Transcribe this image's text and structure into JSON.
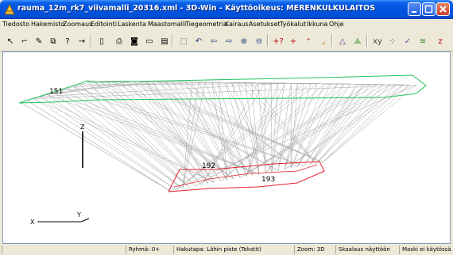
{
  "window": {
    "title": "rauma_12m_rk7_viivamalli_20316.xml - 3D-Win - Käyttöoikeus: MERENKULKULAITOS"
  },
  "menu": [
    "Tiedosto",
    "Hakemisto",
    "Zoomaus",
    "Editointi",
    "Laskenta",
    "Maastomalli",
    "Tiegeometria",
    "Kairaus",
    "Asetukset",
    "Työkalut",
    "Ikkuna",
    "Ohje"
  ],
  "toolbar_icons": [
    "new-point-icon",
    "new-line-icon",
    "edit-icon",
    "copy-icon",
    "query-icon",
    "move-icon",
    "page-icon",
    "print-icon",
    "camera-icon",
    "window-icon",
    "export-icon",
    "zoom-all-icon",
    "undo-zoom-icon",
    "pan-left-icon",
    "pan-right-icon",
    "zoom-in-icon",
    "zoom-out-icon",
    "info-icon",
    "add-point-icon",
    "add-vertex-icon",
    "line-icon",
    "triangle-icon",
    "triangulate-icon",
    "coordinates-icon",
    "grid-points-icon",
    "check-icon",
    "contour-icon",
    "elevation-icon"
  ],
  "canvas": {
    "labels": {
      "outer_line": "151",
      "inner_upper": "192",
      "inner_lower": "193",
      "axis_z": "Z",
      "axis_x": "X",
      "axis_y": "Y"
    },
    "colors": {
      "outer_boundary": "#22c35a",
      "inner_boundary": "#e8202a",
      "mesh": "#a8a8a8"
    }
  },
  "status": {
    "group": "Ryhmä: 0+",
    "snap": "Hakutapa: Lähin piste (Tekstit)",
    "zoom": "Zoom: 3D",
    "scale": "Skaalaus näyttöön",
    "mask": "Maski ei käytössä"
  }
}
